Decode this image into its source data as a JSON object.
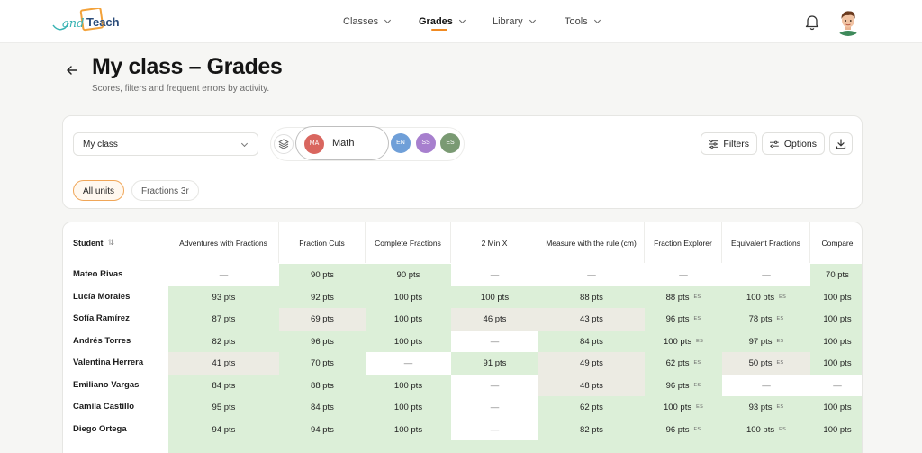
{
  "brand": {
    "logo_text": "Teach",
    "logo_script": "and"
  },
  "nav": {
    "items": [
      {
        "label": "Classes",
        "active": false
      },
      {
        "label": "Grades",
        "active": true
      },
      {
        "label": "Library",
        "active": false
      },
      {
        "label": "Tools",
        "active": false
      }
    ],
    "bell_icon": "bell-icon",
    "avatar_icon": "user-avatar"
  },
  "header": {
    "title": "My class – Grades",
    "subtitle": "Scores, filters and frequent errors by activity."
  },
  "filters": {
    "class_select": "My class",
    "subjects": [
      {
        "code": "MA",
        "name": "Math",
        "color": "#d9665f",
        "selected": true
      },
      {
        "code": "EN",
        "color": "#6f9fd8"
      },
      {
        "code": "SS",
        "color": "#a77fce"
      },
      {
        "code": "ES",
        "color": "#7a9a73"
      }
    ],
    "filters_label": "Filters",
    "options_label": "Options",
    "units": [
      {
        "label": "All units",
        "active": true
      },
      {
        "label": "Fractions 3r",
        "active": false
      }
    ]
  },
  "table": {
    "student_header": "Student",
    "sort_glyph": "⇅",
    "columns": [
      "Adventures with Fractions",
      "Fraction Cuts",
      "Complete Fractions",
      "2 Min X",
      "Measure with the rule (cm)",
      "Fraction Explorer",
      "Equivalent Fractions",
      "Compare"
    ],
    "rows": [
      {
        "name": "Mateo Rivas",
        "cells": [
          {
            "v": "—",
            "t": "w"
          },
          {
            "v": "90 pts",
            "t": "g"
          },
          {
            "v": "90 pts",
            "t": "g"
          },
          {
            "v": "—",
            "t": "w"
          },
          {
            "v": "—",
            "t": "w"
          },
          {
            "v": "—",
            "t": "w"
          },
          {
            "v": "—",
            "t": "w"
          },
          {
            "v": "70 pts",
            "t": "g"
          }
        ]
      },
      {
        "name": "Lucía Morales",
        "cells": [
          {
            "v": "93 pts",
            "t": "g"
          },
          {
            "v": "92 pts",
            "t": "g"
          },
          {
            "v": "100 pts",
            "t": "g"
          },
          {
            "v": "100 pts",
            "t": "g"
          },
          {
            "v": "88 pts",
            "t": "g"
          },
          {
            "v": "88 pts",
            "t": "g",
            "tag": "ES"
          },
          {
            "v": "100 pts",
            "t": "g",
            "tag": "ES"
          },
          {
            "v": "100 pts",
            "t": "g"
          }
        ]
      },
      {
        "name": "Sofía Ramírez",
        "cells": [
          {
            "v": "87 pts",
            "t": "g"
          },
          {
            "v": "69 pts",
            "t": "b"
          },
          {
            "v": "100 pts",
            "t": "g"
          },
          {
            "v": "46 pts",
            "t": "b"
          },
          {
            "v": "43 pts",
            "t": "b"
          },
          {
            "v": "96 pts",
            "t": "g",
            "tag": "ES"
          },
          {
            "v": "78 pts",
            "t": "g",
            "tag": "ES"
          },
          {
            "v": "100 pts",
            "t": "g"
          }
        ]
      },
      {
        "name": "Andrés Torres",
        "cells": [
          {
            "v": "82 pts",
            "t": "g"
          },
          {
            "v": "96 pts",
            "t": "g"
          },
          {
            "v": "100 pts",
            "t": "g"
          },
          {
            "v": "—",
            "t": "w"
          },
          {
            "v": "84 pts",
            "t": "g"
          },
          {
            "v": "100 pts",
            "t": "g",
            "tag": "ES"
          },
          {
            "v": "97 pts",
            "t": "g",
            "tag": "ES"
          },
          {
            "v": "100 pts",
            "t": "g"
          }
        ]
      },
      {
        "name": "Valentina Herrera",
        "cells": [
          {
            "v": "41 pts",
            "t": "b"
          },
          {
            "v": "70 pts",
            "t": "g"
          },
          {
            "v": "—",
            "t": "w"
          },
          {
            "v": "91 pts",
            "t": "g"
          },
          {
            "v": "49 pts",
            "t": "b"
          },
          {
            "v": "62 pts",
            "t": "g",
            "tag": "ES"
          },
          {
            "v": "50 pts",
            "t": "b",
            "tag": "ES"
          },
          {
            "v": "100 pts",
            "t": "g"
          }
        ]
      },
      {
        "name": "Emiliano Vargas",
        "cells": [
          {
            "v": "84 pts",
            "t": "g"
          },
          {
            "v": "88 pts",
            "t": "g"
          },
          {
            "v": "100 pts",
            "t": "g"
          },
          {
            "v": "—",
            "t": "w"
          },
          {
            "v": "48 pts",
            "t": "b"
          },
          {
            "v": "96 pts",
            "t": "g",
            "tag": "ES"
          },
          {
            "v": "—",
            "t": "w"
          },
          {
            "v": "—",
            "t": "w"
          }
        ]
      },
      {
        "name": "Camila Castillo",
        "cells": [
          {
            "v": "95 pts",
            "t": "g"
          },
          {
            "v": "84 pts",
            "t": "g"
          },
          {
            "v": "100 pts",
            "t": "g"
          },
          {
            "v": "—",
            "t": "w"
          },
          {
            "v": "62 pts",
            "t": "g"
          },
          {
            "v": "100 pts",
            "t": "g",
            "tag": "ES"
          },
          {
            "v": "93 pts",
            "t": "g",
            "tag": "ES"
          },
          {
            "v": "100 pts",
            "t": "g"
          }
        ]
      },
      {
        "name": "Diego Ortega",
        "cells": [
          {
            "v": "94 pts",
            "t": "g"
          },
          {
            "v": "94 pts",
            "t": "g"
          },
          {
            "v": "100 pts",
            "t": "g"
          },
          {
            "v": "—",
            "t": "w"
          },
          {
            "v": "82 pts",
            "t": "g"
          },
          {
            "v": "96 pts",
            "t": "g",
            "tag": "ES"
          },
          {
            "v": "100 pts",
            "t": "g",
            "tag": "ES"
          },
          {
            "v": "100 pts",
            "t": "g"
          }
        ]
      },
      {
        "name": "",
        "cells": [
          {
            "v": "",
            "t": "g"
          },
          {
            "v": "",
            "t": "g"
          },
          {
            "v": "",
            "t": "g"
          },
          {
            "v": "",
            "t": "g"
          },
          {
            "v": "",
            "t": "g"
          },
          {
            "v": "",
            "t": "g"
          },
          {
            "v": "",
            "t": "g"
          },
          {
            "v": "",
            "t": "g"
          }
        ]
      }
    ]
  }
}
